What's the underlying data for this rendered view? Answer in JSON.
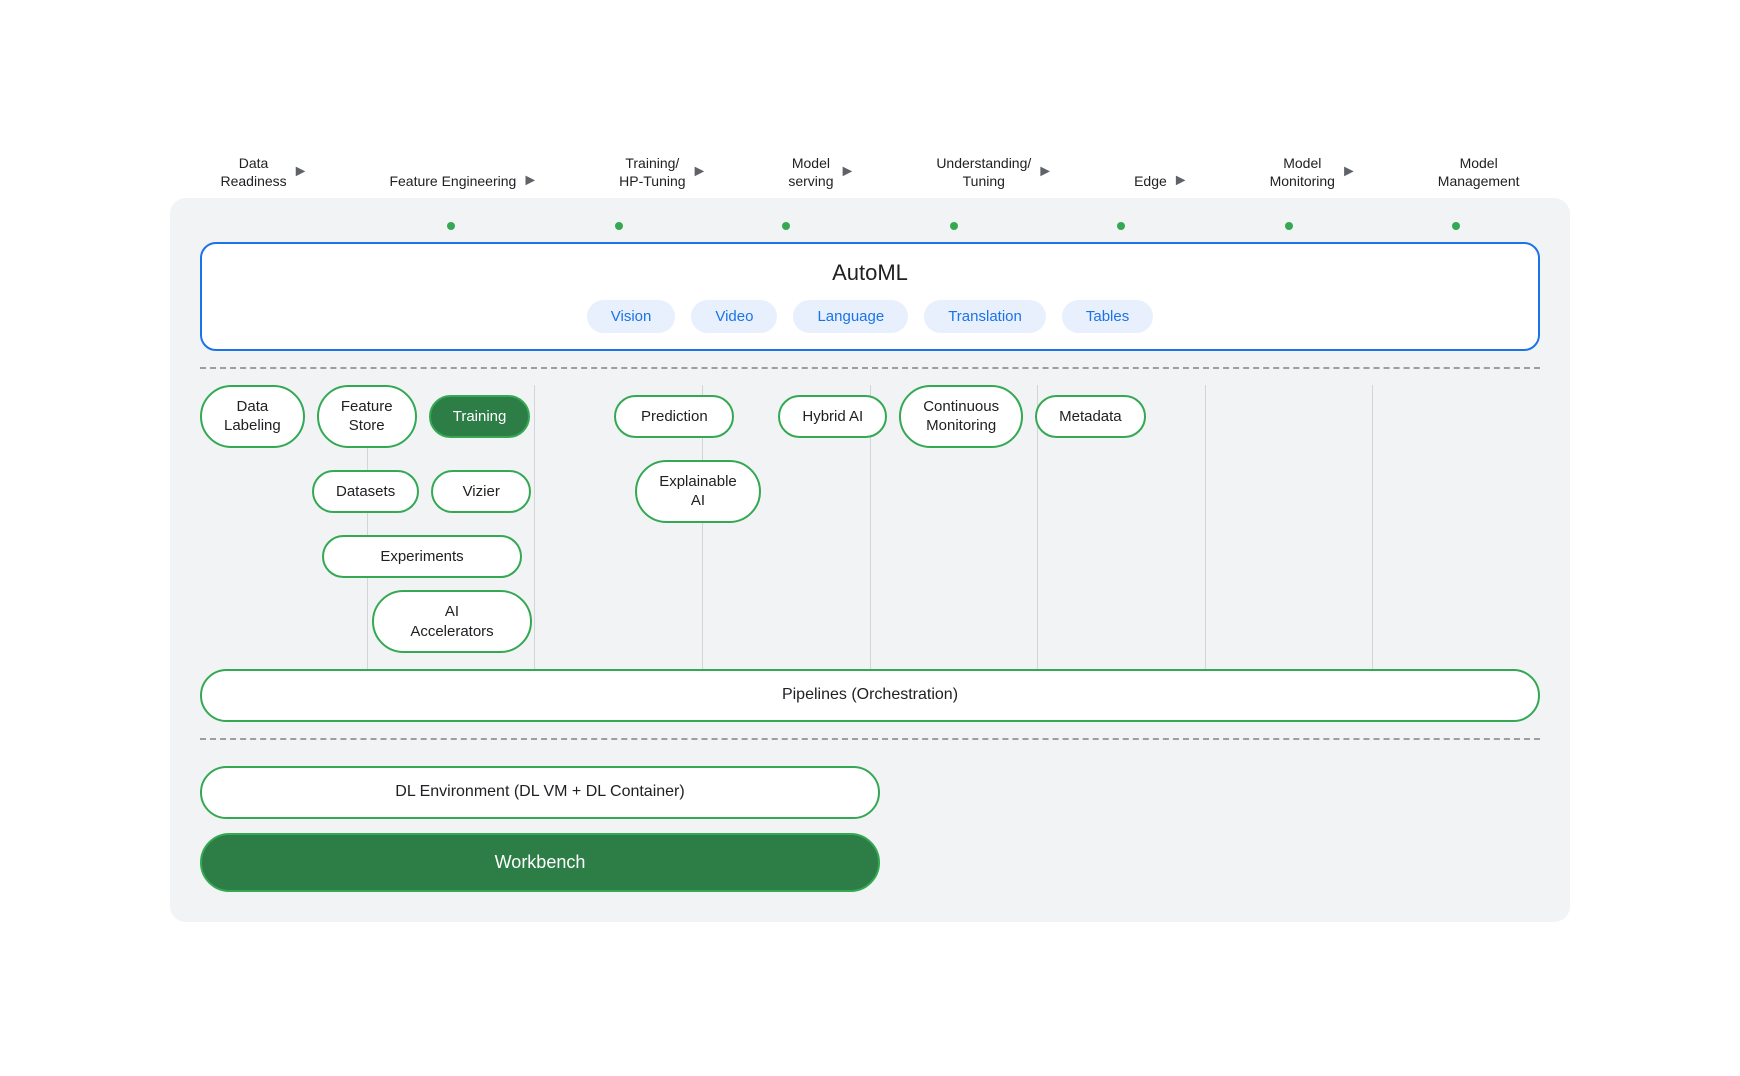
{
  "top_labels": [
    {
      "label": "Data\nReadiness",
      "has_arrow": true
    },
    {
      "label": "Feature\nEngineering",
      "has_arrow": true
    },
    {
      "label": "Training/\nHP-Tuning",
      "has_arrow": true
    },
    {
      "label": "Model\nserving",
      "has_arrow": true
    },
    {
      "label": "Understanding/\nTuning",
      "has_arrow": true
    },
    {
      "label": "Edge",
      "has_arrow": true
    },
    {
      "label": "Model\nMonitoring",
      "has_arrow": true
    },
    {
      "label": "Model\nManagement",
      "has_arrow": false
    }
  ],
  "automl": {
    "title": "AutoML",
    "pills": [
      "Vision",
      "Video",
      "Language",
      "Translation",
      "Tables"
    ]
  },
  "main_items": {
    "row1": [
      {
        "label": "Data\nLabeling",
        "filled": false
      },
      {
        "label": "Feature\nStore",
        "filled": false
      },
      {
        "label": "Training",
        "filled": true
      },
      {
        "label": "Prediction",
        "filled": false
      },
      {
        "label": "Hybrid AI",
        "filled": false
      },
      {
        "label": "Continuous\nMonitoring",
        "filled": false
      },
      {
        "label": "Metadata",
        "filled": false
      }
    ],
    "row2": [
      {
        "label": "Datasets",
        "filled": false
      },
      {
        "label": "Vizier",
        "filled": false
      },
      {
        "label": "Explainable\nAI",
        "filled": false
      }
    ],
    "row3": [
      {
        "label": "Experiments",
        "filled": false
      }
    ],
    "row4": [
      {
        "label": "AI\nAccelerators",
        "filled": false
      }
    ]
  },
  "pipelines": {
    "label": "Pipelines (Orchestration)"
  },
  "bottom": {
    "dl_env": "DL Environment (DL VM + DL Container)",
    "workbench": "Workbench"
  }
}
